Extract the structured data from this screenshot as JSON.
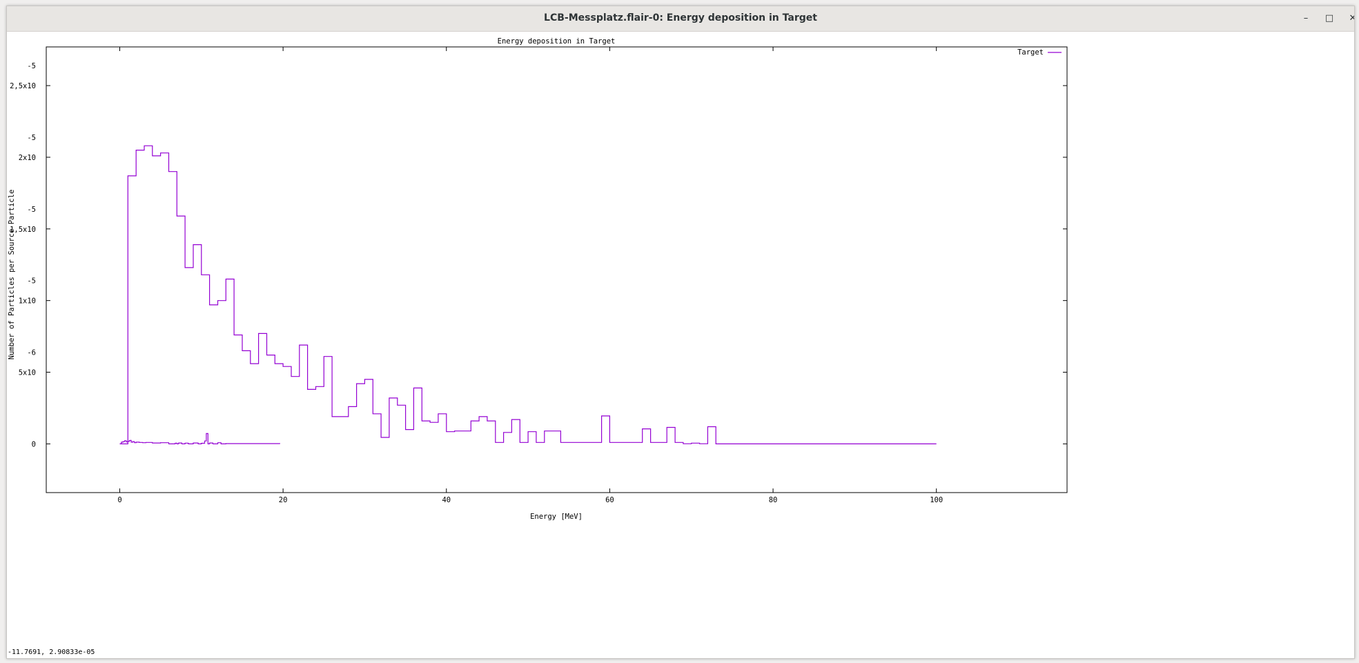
{
  "window": {
    "title": "LCB-Messplatz.flair-0: Energy deposition in Target",
    "minimize_glyph": "–",
    "maximize_glyph": "□",
    "close_glyph": "✕"
  },
  "status": {
    "coords": "-11.7691,  2.90833e-05"
  },
  "chart_data": {
    "type": "line",
    "step": true,
    "title": "Energy deposition in Target",
    "xlabel": "Energy [MeV]",
    "ylabel": "Number of Particles per Source Particle",
    "xlim": [
      -9,
      116
    ],
    "ylim": [
      -3.4e-06,
      2.77e-05
    ],
    "xticks": [
      0,
      20,
      40,
      60,
      80,
      100
    ],
    "xtick_labels": [
      "0",
      "20",
      "40",
      "60",
      "80",
      "100"
    ],
    "yticks": [
      {
        "value": 0,
        "mant": "0",
        "exp": ""
      },
      {
        "value": 5e-06,
        "mant": "5x10",
        "exp": "-6"
      },
      {
        "value": 1e-05,
        "mant": "1x10",
        "exp": "-5"
      },
      {
        "value": 1.5e-05,
        "mant": "1,5x10",
        "exp": "-5"
      },
      {
        "value": 2e-05,
        "mant": "2x10",
        "exp": "-5"
      },
      {
        "value": 2.5e-05,
        "mant": "2,5x10",
        "exp": "-5"
      }
    ],
    "grid": false,
    "legend": "top-right",
    "color": "#9400d3",
    "series": [
      {
        "name": "Target",
        "x": [
          0,
          1,
          2,
          3,
          4,
          5,
          6,
          7,
          8,
          9,
          10,
          11,
          12,
          13,
          14,
          15,
          16,
          17,
          18,
          19,
          20,
          21,
          22,
          23,
          24,
          25,
          26,
          27,
          28,
          29,
          30,
          31,
          32,
          33,
          34,
          35,
          36,
          37,
          38,
          39,
          40,
          41,
          42,
          43,
          44,
          45,
          46,
          47,
          48,
          49,
          50,
          51,
          52,
          53,
          54,
          55,
          56,
          57,
          58,
          59,
          60,
          61,
          62,
          63,
          64,
          65,
          66,
          67,
          68,
          69,
          70,
          71,
          72,
          73,
          74,
          75,
          76,
          77,
          78,
          79,
          80,
          81,
          82,
          83,
          84,
          85,
          86,
          87,
          88,
          89,
          90,
          91,
          92,
          93,
          94,
          95,
          96,
          97,
          98,
          99,
          100
        ],
        "y": [
          0,
          1.87e-05,
          2.05e-05,
          2.08e-05,
          2.01e-05,
          2.03e-05,
          1.9e-05,
          1.59e-05,
          1.23e-05,
          1.39e-05,
          1.18e-05,
          9.7e-06,
          1e-05,
          1.15e-05,
          7.6e-06,
          6.5e-06,
          5.6e-06,
          7.7e-06,
          6.2e-06,
          5.6e-06,
          5.4e-06,
          4.7e-06,
          6.9e-06,
          3.8e-06,
          4e-06,
          6.1e-06,
          1.9e-06,
          1.9e-06,
          2.6e-06,
          4.2e-06,
          4.5e-06,
          2.1e-06,
          4.5e-07,
          3.2e-06,
          2.7e-06,
          1e-06,
          3.9e-06,
          1.6e-06,
          1.5e-06,
          2.1e-06,
          8.5e-07,
          9e-07,
          9e-07,
          1.6e-06,
          1.9e-06,
          1.6e-06,
          1e-07,
          8e-07,
          1.7e-06,
          1e-07,
          8.5e-07,
          1e-07,
          9e-07,
          9e-07,
          1e-07,
          1e-07,
          1e-07,
          1e-07,
          1e-07,
          1.95e-06,
          1e-07,
          1e-07,
          1e-07,
          1e-07,
          1.05e-06,
          1e-07,
          1e-07,
          1.15e-06,
          1e-07,
          1e-08,
          5e-08,
          1e-08,
          1.2e-06,
          0,
          0,
          0,
          0,
          0,
          0,
          0,
          0,
          0,
          0,
          0,
          0,
          0,
          0,
          0,
          0,
          0,
          0,
          0,
          0,
          0,
          0,
          0,
          0,
          0,
          0,
          0,
          0
        ]
      },
      {
        "name": "",
        "x": [
          0,
          0.2,
          0.4,
          0.6,
          0.8,
          1.0,
          1.2,
          1.4,
          1.6,
          1.8,
          2.0,
          2.4,
          2.8,
          3.2,
          4.0,
          5.0,
          6.0,
          6.8,
          7.0,
          7.2,
          7.6,
          8.0,
          8.4,
          9.0,
          9.6,
          10.0,
          10.4,
          10.6,
          10.8,
          11.0,
          11.4,
          12.0,
          12.4,
          13.0,
          19.6
        ],
        "y": [
          0,
          1.2e-07,
          1.6e-07,
          2.2e-07,
          1.4e-07,
          1.8e-07,
          2.4e-07,
          1.2e-07,
          1.6e-07,
          8e-08,
          1.2e-07,
          1e-07,
          8e-08,
          1e-07,
          6e-08,
          8e-08,
          0,
          5e-08,
          0,
          6e-08,
          0,
          5e-08,
          0,
          6e-08,
          0,
          4e-08,
          2e-07,
          7.2e-07,
          0,
          6e-08,
          0,
          8e-08,
          0,
          2e-08,
          0
        ]
      }
    ]
  }
}
